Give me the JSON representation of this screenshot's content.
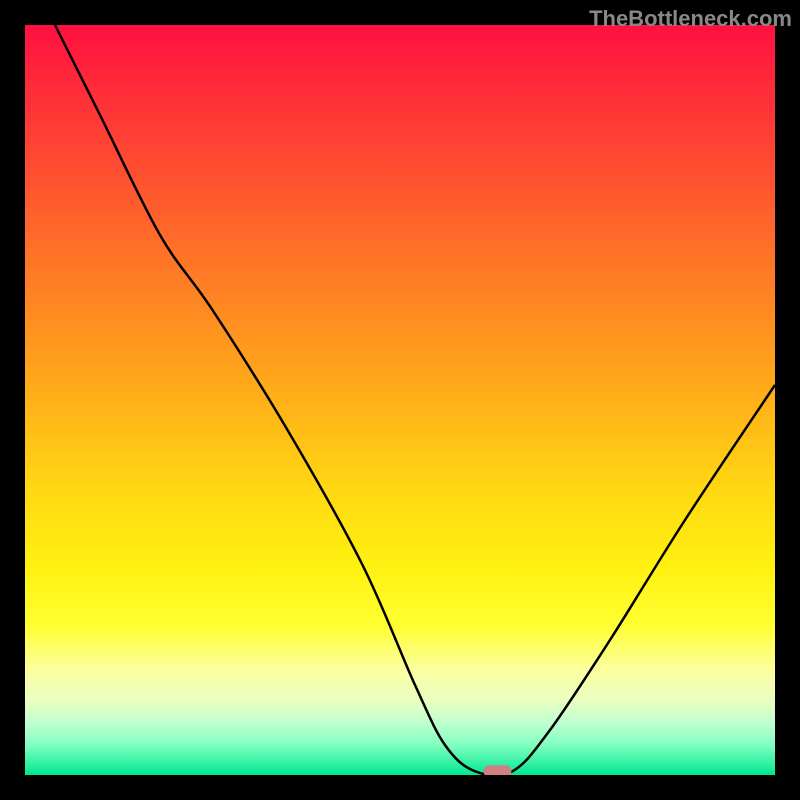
{
  "watermark": "TheBottleneck.com",
  "chart_data": {
    "type": "line",
    "title": "",
    "xlabel": "",
    "ylabel": "",
    "xlim": [
      0,
      100
    ],
    "ylim": [
      0,
      100
    ],
    "curve_points": [
      {
        "x": 4,
        "y": 100
      },
      {
        "x": 10,
        "y": 88
      },
      {
        "x": 18,
        "y": 72
      },
      {
        "x": 25,
        "y": 62
      },
      {
        "x": 35,
        "y": 46
      },
      {
        "x": 45,
        "y": 28
      },
      {
        "x": 52,
        "y": 12
      },
      {
        "x": 56,
        "y": 4
      },
      {
        "x": 60,
        "y": 0.5
      },
      {
        "x": 65,
        "y": 0.5
      },
      {
        "x": 70,
        "y": 6
      },
      {
        "x": 78,
        "y": 18
      },
      {
        "x": 88,
        "y": 34
      },
      {
        "x": 100,
        "y": 52
      }
    ],
    "marker": {
      "x": 63,
      "y": 0.5,
      "color": "#d08080"
    },
    "background": "red-yellow-green vertical gradient",
    "description": "V-shaped bottleneck curve with minimum near x=63"
  }
}
